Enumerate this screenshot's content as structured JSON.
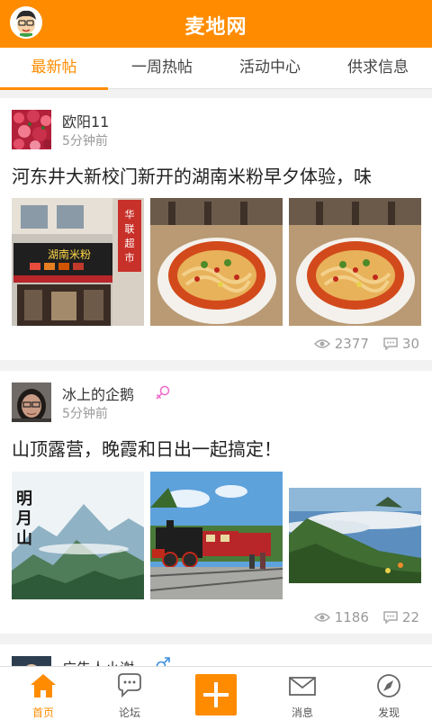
{
  "app": {
    "title": "麦地网",
    "accent": "#ff8c00"
  },
  "header": {
    "avatar_icon": "cartoon-avatar-icon"
  },
  "tabs": [
    {
      "label": "最新帖",
      "active": true
    },
    {
      "label": "一周热帖",
      "active": false
    },
    {
      "label": "活动中心",
      "active": false
    },
    {
      "label": "供求信息",
      "active": false
    }
  ],
  "posts": [
    {
      "user": "欧阳11",
      "time": "5分钟前",
      "gender": "",
      "text": "河东井大新校门新开的湖南米粉早夕体验，味",
      "views": "2377",
      "comments": "30",
      "images": [
        "shop-front-photo",
        "noodle-bowl-photo",
        "noodle-bowl-photo"
      ],
      "sign_text": "湖南米粉",
      "sign_side": "华联超市"
    },
    {
      "user": "冰上的企鹅",
      "time": "5分钟前",
      "gender": "female",
      "text": "山顶露营，晚霞和日出一起搞定！",
      "views": "1186",
      "comments": "22",
      "images": [
        "mountain-poster-photo",
        "steam-train-photo",
        "sea-of-clouds-photo"
      ],
      "poster_text": "明月山"
    },
    {
      "user": "广告人小谢",
      "gender": "male"
    }
  ],
  "bottomnav": [
    {
      "label": "首页",
      "icon": "home-icon",
      "active": true
    },
    {
      "label": "论坛",
      "icon": "chat-bubble-icon",
      "active": false
    },
    {
      "label": "",
      "icon": "plus-icon",
      "active": false
    },
    {
      "label": "消息",
      "icon": "envelope-icon",
      "active": false
    },
    {
      "label": "发现",
      "icon": "compass-icon",
      "active": false
    }
  ]
}
